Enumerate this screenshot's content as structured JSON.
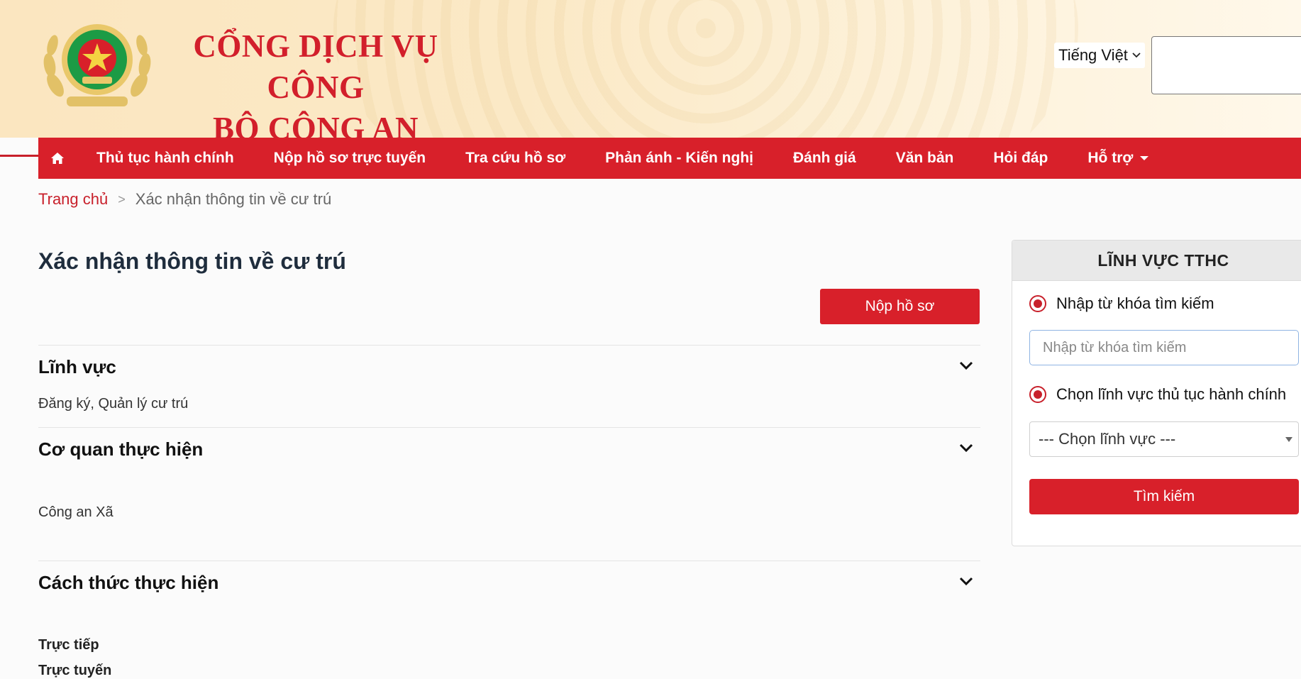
{
  "header": {
    "brand_line1": "CỔNG DỊCH VỤ CÔNG",
    "brand_line2": "BỘ CÔNG AN",
    "language": "Tiếng Việt",
    "search_value": ""
  },
  "nav": {
    "home_icon": "home-icon",
    "items": [
      "Thủ tục hành chính",
      "Nộp hồ sơ trực tuyến",
      "Tra cứu hồ sơ",
      "Phản ánh - Kiến nghị",
      "Đánh giá",
      "Văn bản",
      "Hỏi đáp",
      "Hỗ trợ"
    ]
  },
  "breadcrumb": {
    "home": "Trang chủ",
    "separator": ">",
    "current": "Xác nhận thông tin về cư trú"
  },
  "main": {
    "title": "Xác nhận thông tin về cư trú",
    "submit_label": "Nộp hồ sơ",
    "sections": [
      {
        "title": "Lĩnh vực",
        "content": [
          "Đăng ký, Quản lý cư trú"
        ]
      },
      {
        "title": "Cơ quan thực hiện",
        "content": [
          "Công an Xã"
        ]
      },
      {
        "title": "Cách thức thực hiện",
        "content": [
          "Trực tiếp",
          "Trực tuyến"
        ]
      }
    ]
  },
  "sidebar": {
    "title": "LĨNH VỰC TTHC",
    "radio_keyword_label": "Nhập từ khóa tìm kiếm",
    "keyword_placeholder": "Nhập từ khóa tìm kiếm",
    "radio_field_label": "Chọn lĩnh vực thủ tục hành chính",
    "select_value": "--- Chọn lĩnh vực ---",
    "search_label": "Tìm kiếm"
  },
  "colors": {
    "accent": "#d8202a",
    "header_bg": "#fbe8c3",
    "title_text": "#1f2d3d"
  }
}
